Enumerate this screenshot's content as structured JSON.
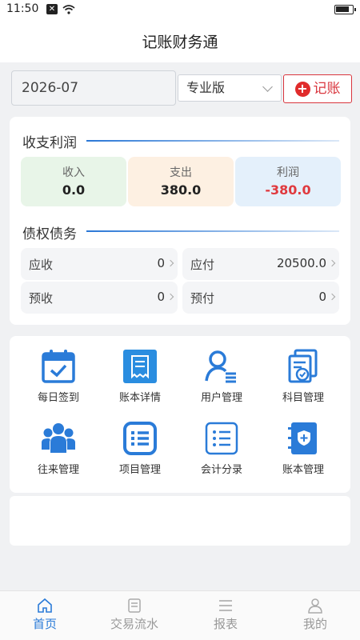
{
  "status_bar": {
    "time": "11:50"
  },
  "header": {
    "title": "记账财务通"
  },
  "controls": {
    "month": "2026-07",
    "version": "专业版",
    "add_label": "记账"
  },
  "income_section": {
    "title": "收支利润",
    "items": [
      {
        "label": "收入",
        "value": "0.0",
        "bg": "#e8f5e8",
        "color": "#222222"
      },
      {
        "label": "支出",
        "value": "380.0",
        "bg": "#fdf0e2",
        "color": "#222222"
      },
      {
        "label": "利润",
        "value": "-380.0",
        "bg": "#e4f0fb",
        "color": "#e0393e"
      }
    ]
  },
  "debt_section": {
    "title": "债权债务",
    "items": [
      {
        "label": "应收",
        "value": "0"
      },
      {
        "label": "应付",
        "value": "20500.0"
      },
      {
        "label": "预收",
        "value": "0"
      },
      {
        "label": "预付",
        "value": "0"
      }
    ]
  },
  "grid": [
    {
      "label": "每日签到",
      "icon": "calendar-check-icon"
    },
    {
      "label": "账本详情",
      "icon": "receipt-icon"
    },
    {
      "label": "用户管理",
      "icon": "user-manage-icon"
    },
    {
      "label": "科目管理",
      "icon": "documents-icon"
    },
    {
      "label": "往来管理",
      "icon": "group-icon"
    },
    {
      "label": "项目管理",
      "icon": "list-box-icon"
    },
    {
      "label": "会计分录",
      "icon": "list-lines-icon"
    },
    {
      "label": "账本管理",
      "icon": "ledger-book-icon"
    }
  ],
  "tabbar": [
    {
      "label": "首页",
      "active": true
    },
    {
      "label": "交易流水",
      "active": false
    },
    {
      "label": "报表",
      "active": false
    },
    {
      "label": "我的",
      "active": false
    }
  ],
  "colors": {
    "accent": "#2a7bd8",
    "danger": "#e02b2b"
  }
}
